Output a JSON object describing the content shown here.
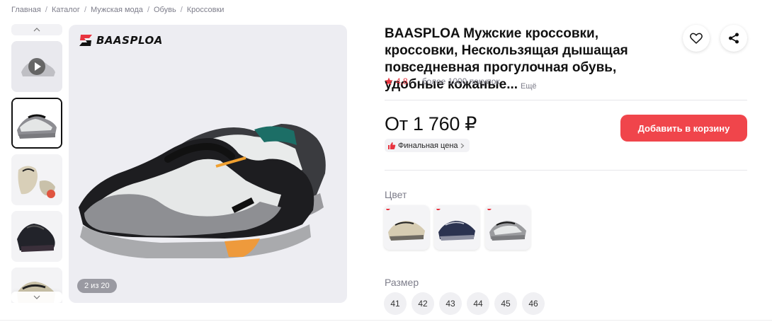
{
  "breadcrumb": [
    "Главная",
    "Каталог",
    "Мужская мода",
    "Обувь",
    "Кроссовки"
  ],
  "breadcrumb_separator": "/",
  "gallery": {
    "brand": "BAASPLOA",
    "counter": "2 из 20",
    "thumb_count_visible": 5,
    "active_index": 1
  },
  "product": {
    "title": "BAASPLOA Мужские кроссовки, кроссовки, Нескользящая дышащая повседневная прогулочная обувь, удобные кожаные...",
    "more_label": "Ещё",
    "rating": "4,8",
    "rating_dot": "·",
    "purchases": "более 1000 покупок",
    "price": "От 1 760 ₽",
    "final_price_label": "Финальная цена",
    "add_to_cart": "Добавить в корзину"
  },
  "colors_label": "Цвет",
  "colors": [
    "beige",
    "navy",
    "grey"
  ],
  "sizes_label": "Размер",
  "sizes": [
    "41",
    "42",
    "43",
    "44",
    "45",
    "46"
  ],
  "accent": "#f0454b",
  "icons": {
    "favorite": "heart-icon",
    "share": "share-icon",
    "rating": "star-icon",
    "final_price": "thumb-up-icon"
  }
}
